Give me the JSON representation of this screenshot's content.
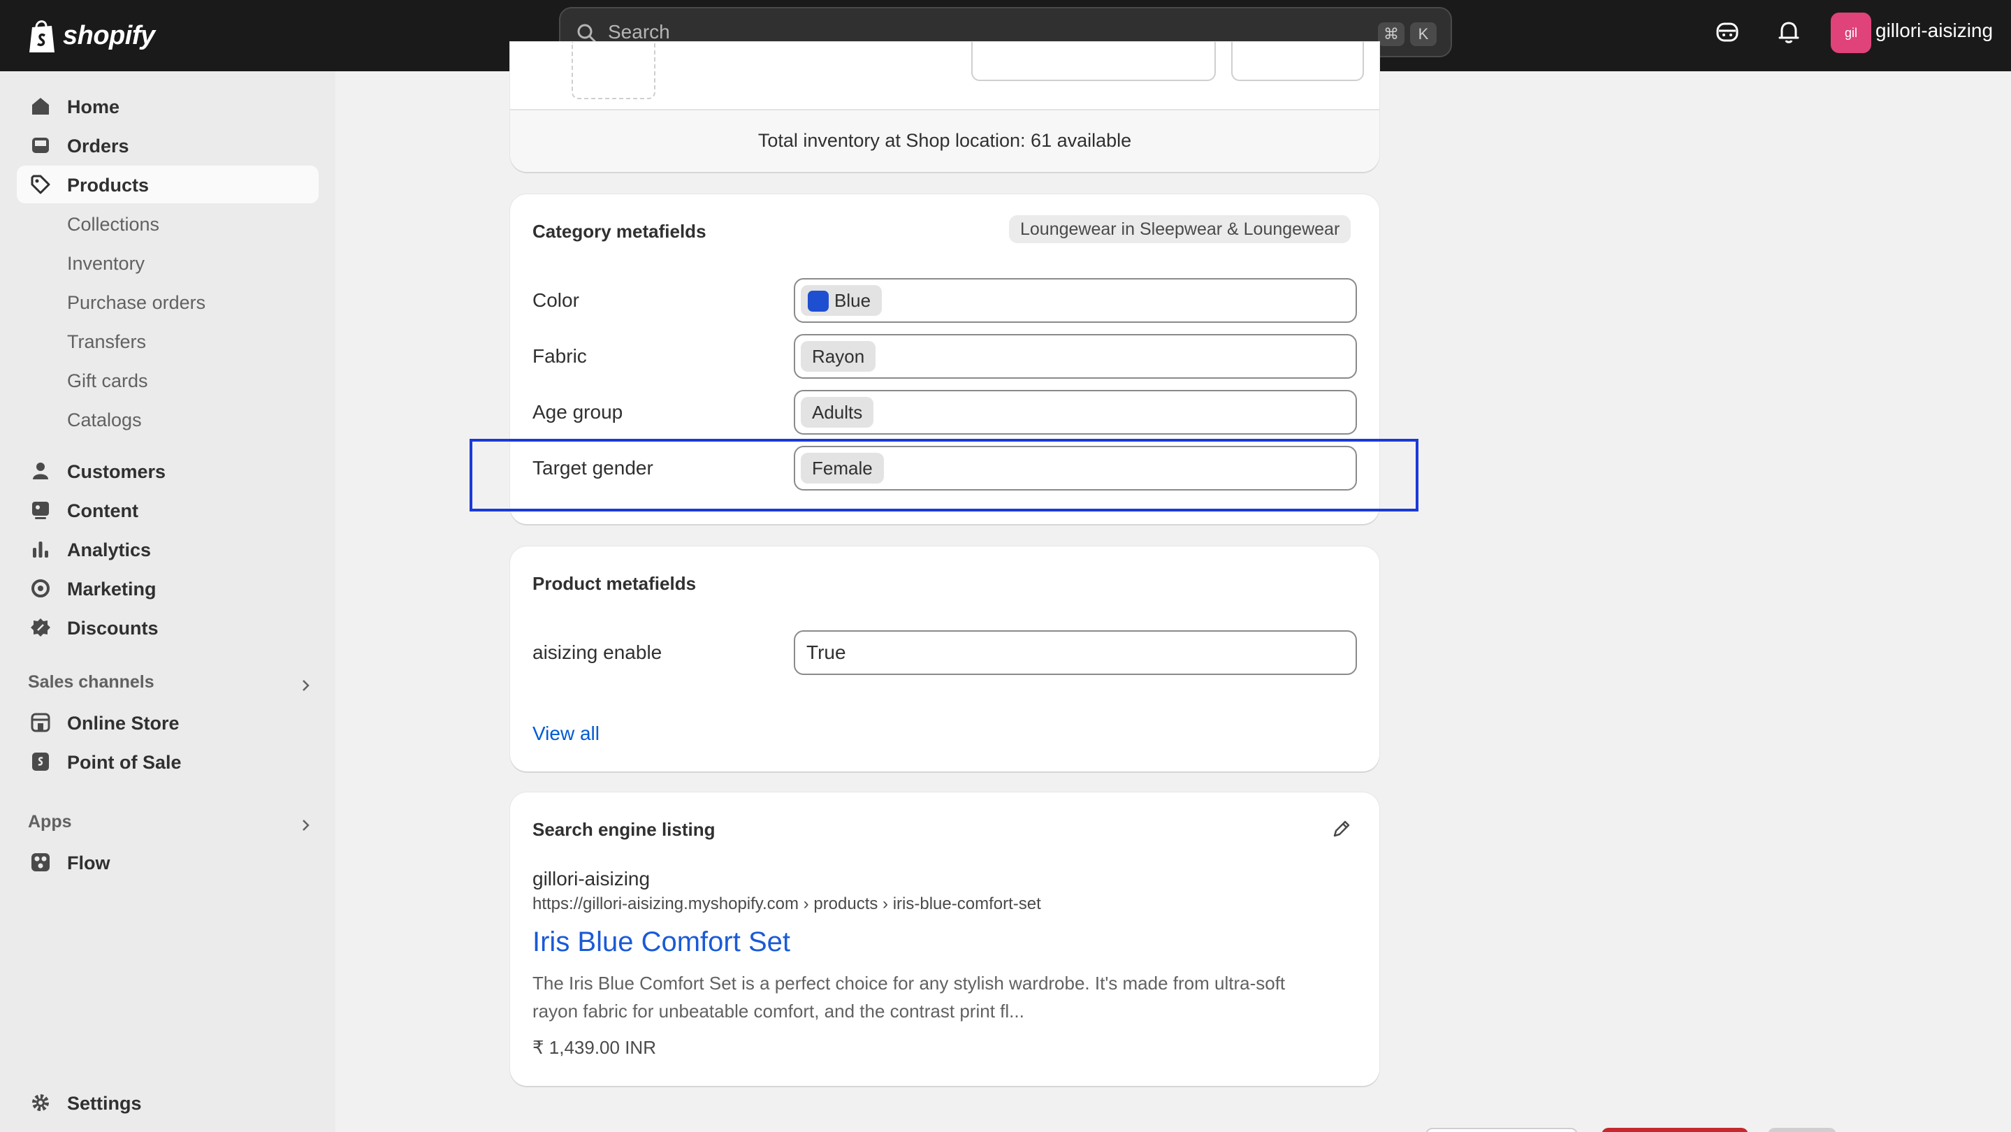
{
  "topbar": {
    "logo_text": "shopify",
    "search_placeholder": "Search",
    "shortcut_cmd": "⌘",
    "shortcut_key": "K",
    "avatar_initials": "gil",
    "store_name": "gillori-aisizing"
  },
  "sidebar": {
    "main_items": [
      {
        "label": "Home",
        "icon": "home-icon"
      },
      {
        "label": "Orders",
        "icon": "inbox-icon"
      },
      {
        "label": "Products",
        "icon": "tag-icon"
      }
    ],
    "product_sub_items": [
      "Collections",
      "Inventory",
      "Purchase orders",
      "Transfers",
      "Gift cards",
      "Catalogs"
    ],
    "more_items": [
      {
        "label": "Customers",
        "icon": "person-icon"
      },
      {
        "label": "Content",
        "icon": "content-icon"
      },
      {
        "label": "Analytics",
        "icon": "bar-chart-icon"
      },
      {
        "label": "Marketing",
        "icon": "target-icon"
      },
      {
        "label": "Discounts",
        "icon": "discount-icon"
      }
    ],
    "sales_channels_label": "Sales channels",
    "sales_channels": [
      {
        "label": "Online Store",
        "icon": "store-icon"
      },
      {
        "label": "Point of Sale",
        "icon": "pos-icon"
      }
    ],
    "apps_label": "Apps",
    "apps": [
      {
        "label": "Flow",
        "icon": "flow-icon"
      }
    ],
    "settings_label": "Settings"
  },
  "inventory_card": {
    "total_text": "Total inventory at Shop location: 61 available"
  },
  "category_metafields": {
    "title": "Category metafields",
    "category_badge": "Loungewear in Sleepwear & Loungewear",
    "fields": [
      {
        "label": "Color",
        "value": "Blue",
        "swatch_color": "#1f4fd1"
      },
      {
        "label": "Fabric",
        "value": "Rayon"
      },
      {
        "label": "Age group",
        "value": "Adults"
      },
      {
        "label": "Target gender",
        "value": "Female"
      }
    ]
  },
  "product_metafields": {
    "title": "Product metafields",
    "fields": [
      {
        "label": "aisizing enable",
        "value": "True"
      }
    ],
    "view_all": "View all"
  },
  "seo": {
    "title": "Search engine listing",
    "store": "gillori-aisizing",
    "url": "https://gillori-aisizing.myshopify.com › products › iris-blue-comfort-set",
    "page_title": "Iris Blue Comfort Set",
    "description_line1": "The Iris Blue Comfort Set is a perfect choice for any stylish wardrobe. It's made from ultra-soft",
    "description_line2": "rayon fabric for unbeatable comfort, and the contrast print fl...",
    "price": "₹ 1,439.00 INR"
  },
  "colors": {
    "highlight": "#1a3ad6",
    "link": "#005bd3",
    "avatar": "#e0427a"
  }
}
